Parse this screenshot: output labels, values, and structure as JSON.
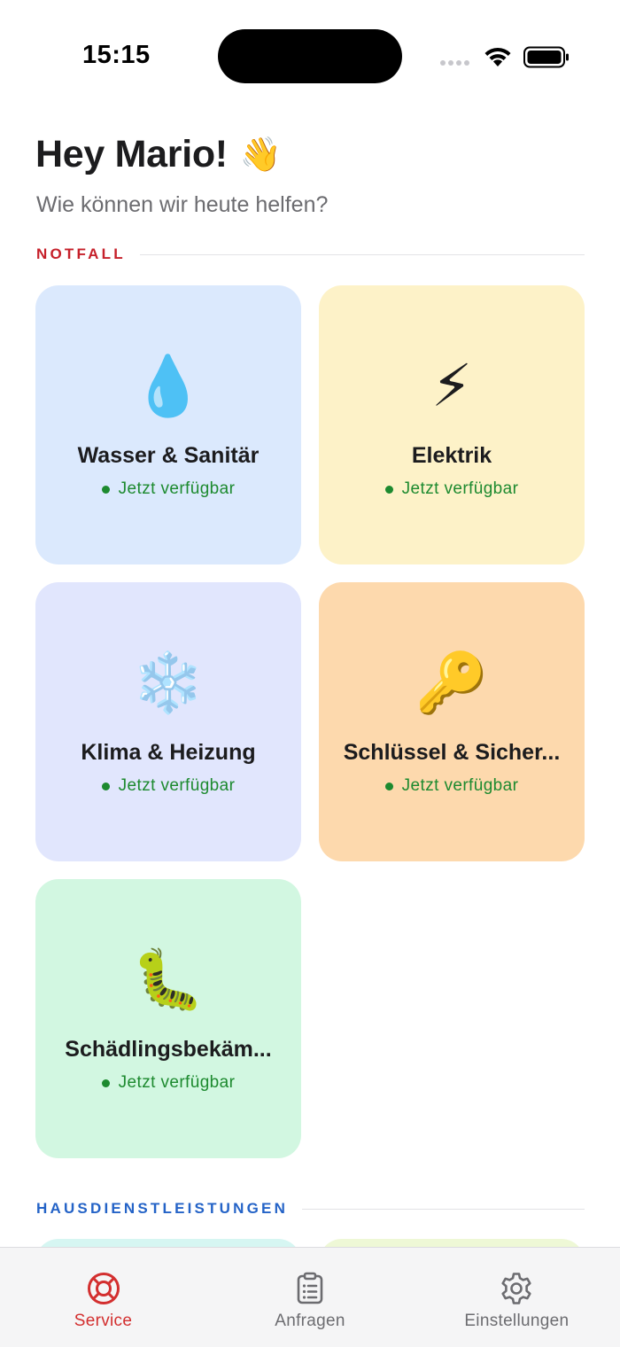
{
  "status_bar": {
    "time": "15:15"
  },
  "header": {
    "greeting": "Hey Mario!",
    "greeting_emoji": "👋",
    "subtitle": "Wie können wir heute helfen?"
  },
  "sections": {
    "emergency": {
      "label": "NOTFALL",
      "color": "#c6202a"
    },
    "home_services": {
      "label": "HAUSDIENSTLEISTUNGEN",
      "color": "#2463c7"
    }
  },
  "emergency_cards": [
    {
      "title": "Wasser & Sanitär",
      "icon": "💧",
      "icon_name": "water-drop-icon",
      "status": "Jetzt verfügbar",
      "background": "#dbe9fd"
    },
    {
      "title": "Elektrik",
      "icon": "⚡",
      "icon_name": "lightning-icon",
      "status": "Jetzt verfügbar",
      "background": "#fdf2c8"
    },
    {
      "title": "Klima & Heizung",
      "icon": "❄️",
      "icon_name": "snowflake-icon",
      "status": "Jetzt verfügbar",
      "background": "#e1e6fd"
    },
    {
      "title": "Schlüssel & Sicher...",
      "icon": "🔑",
      "icon_name": "key-icon",
      "status": "Jetzt verfügbar",
      "background": "#fdd9ad"
    },
    {
      "title": "Schädlingsbekäm...",
      "icon": "🐛",
      "icon_name": "caterpillar-icon",
      "status": "Jetzt verfügbar",
      "background": "#d2f7e1"
    }
  ],
  "status_color": "#1d8a2f",
  "tab_bar": {
    "tabs": [
      {
        "label": "Service",
        "icon_name": "lifebuoy-icon",
        "active": true
      },
      {
        "label": "Anfragen",
        "icon_name": "clipboard-icon",
        "active": false
      },
      {
        "label": "Einstellungen",
        "icon_name": "gear-icon",
        "active": false
      }
    ],
    "active_color": "#d32f2f"
  }
}
